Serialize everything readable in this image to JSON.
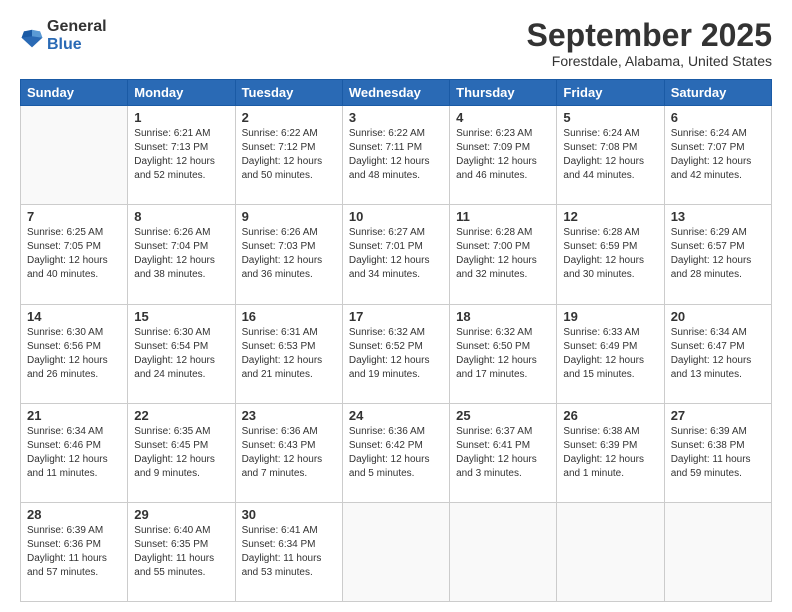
{
  "logo": {
    "general": "General",
    "blue": "Blue"
  },
  "title": {
    "month": "September 2025",
    "location": "Forestdale, Alabama, United States"
  },
  "headers": [
    "Sunday",
    "Monday",
    "Tuesday",
    "Wednesday",
    "Thursday",
    "Friday",
    "Saturday"
  ],
  "weeks": [
    [
      {
        "day": "",
        "info": ""
      },
      {
        "day": "1",
        "info": "Sunrise: 6:21 AM\nSunset: 7:13 PM\nDaylight: 12 hours\nand 52 minutes."
      },
      {
        "day": "2",
        "info": "Sunrise: 6:22 AM\nSunset: 7:12 PM\nDaylight: 12 hours\nand 50 minutes."
      },
      {
        "day": "3",
        "info": "Sunrise: 6:22 AM\nSunset: 7:11 PM\nDaylight: 12 hours\nand 48 minutes."
      },
      {
        "day": "4",
        "info": "Sunrise: 6:23 AM\nSunset: 7:09 PM\nDaylight: 12 hours\nand 46 minutes."
      },
      {
        "day": "5",
        "info": "Sunrise: 6:24 AM\nSunset: 7:08 PM\nDaylight: 12 hours\nand 44 minutes."
      },
      {
        "day": "6",
        "info": "Sunrise: 6:24 AM\nSunset: 7:07 PM\nDaylight: 12 hours\nand 42 minutes."
      }
    ],
    [
      {
        "day": "7",
        "info": "Sunrise: 6:25 AM\nSunset: 7:05 PM\nDaylight: 12 hours\nand 40 minutes."
      },
      {
        "day": "8",
        "info": "Sunrise: 6:26 AM\nSunset: 7:04 PM\nDaylight: 12 hours\nand 38 minutes."
      },
      {
        "day": "9",
        "info": "Sunrise: 6:26 AM\nSunset: 7:03 PM\nDaylight: 12 hours\nand 36 minutes."
      },
      {
        "day": "10",
        "info": "Sunrise: 6:27 AM\nSunset: 7:01 PM\nDaylight: 12 hours\nand 34 minutes."
      },
      {
        "day": "11",
        "info": "Sunrise: 6:28 AM\nSunset: 7:00 PM\nDaylight: 12 hours\nand 32 minutes."
      },
      {
        "day": "12",
        "info": "Sunrise: 6:28 AM\nSunset: 6:59 PM\nDaylight: 12 hours\nand 30 minutes."
      },
      {
        "day": "13",
        "info": "Sunrise: 6:29 AM\nSunset: 6:57 PM\nDaylight: 12 hours\nand 28 minutes."
      }
    ],
    [
      {
        "day": "14",
        "info": "Sunrise: 6:30 AM\nSunset: 6:56 PM\nDaylight: 12 hours\nand 26 minutes."
      },
      {
        "day": "15",
        "info": "Sunrise: 6:30 AM\nSunset: 6:54 PM\nDaylight: 12 hours\nand 24 minutes."
      },
      {
        "day": "16",
        "info": "Sunrise: 6:31 AM\nSunset: 6:53 PM\nDaylight: 12 hours\nand 21 minutes."
      },
      {
        "day": "17",
        "info": "Sunrise: 6:32 AM\nSunset: 6:52 PM\nDaylight: 12 hours\nand 19 minutes."
      },
      {
        "day": "18",
        "info": "Sunrise: 6:32 AM\nSunset: 6:50 PM\nDaylight: 12 hours\nand 17 minutes."
      },
      {
        "day": "19",
        "info": "Sunrise: 6:33 AM\nSunset: 6:49 PM\nDaylight: 12 hours\nand 15 minutes."
      },
      {
        "day": "20",
        "info": "Sunrise: 6:34 AM\nSunset: 6:47 PM\nDaylight: 12 hours\nand 13 minutes."
      }
    ],
    [
      {
        "day": "21",
        "info": "Sunrise: 6:34 AM\nSunset: 6:46 PM\nDaylight: 12 hours\nand 11 minutes."
      },
      {
        "day": "22",
        "info": "Sunrise: 6:35 AM\nSunset: 6:45 PM\nDaylight: 12 hours\nand 9 minutes."
      },
      {
        "day": "23",
        "info": "Sunrise: 6:36 AM\nSunset: 6:43 PM\nDaylight: 12 hours\nand 7 minutes."
      },
      {
        "day": "24",
        "info": "Sunrise: 6:36 AM\nSunset: 6:42 PM\nDaylight: 12 hours\nand 5 minutes."
      },
      {
        "day": "25",
        "info": "Sunrise: 6:37 AM\nSunset: 6:41 PM\nDaylight: 12 hours\nand 3 minutes."
      },
      {
        "day": "26",
        "info": "Sunrise: 6:38 AM\nSunset: 6:39 PM\nDaylight: 12 hours\nand 1 minute."
      },
      {
        "day": "27",
        "info": "Sunrise: 6:39 AM\nSunset: 6:38 PM\nDaylight: 11 hours\nand 59 minutes."
      }
    ],
    [
      {
        "day": "28",
        "info": "Sunrise: 6:39 AM\nSunset: 6:36 PM\nDaylight: 11 hours\nand 57 minutes."
      },
      {
        "day": "29",
        "info": "Sunrise: 6:40 AM\nSunset: 6:35 PM\nDaylight: 11 hours\nand 55 minutes."
      },
      {
        "day": "30",
        "info": "Sunrise: 6:41 AM\nSunset: 6:34 PM\nDaylight: 11 hours\nand 53 minutes."
      },
      {
        "day": "",
        "info": ""
      },
      {
        "day": "",
        "info": ""
      },
      {
        "day": "",
        "info": ""
      },
      {
        "day": "",
        "info": ""
      }
    ]
  ]
}
